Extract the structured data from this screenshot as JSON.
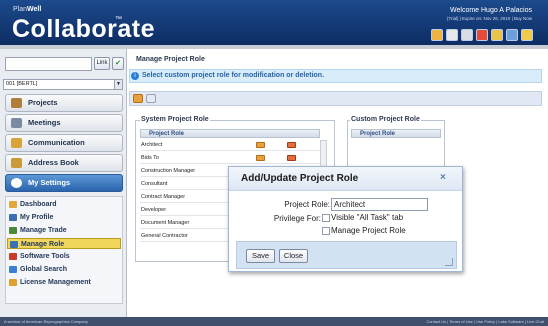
{
  "header": {
    "brand_top_a": "Plan",
    "brand_top_b": "Well",
    "brand_main": "Collaborate",
    "brand_tm": "™",
    "welcome": "Welcome Hugo A Palacios",
    "expire": "[Trial] | Expire on: Nov 26, 2010 | Buy Now",
    "toolbar_icons": [
      "help-icon",
      "home-icon",
      "print-icon",
      "close-icon",
      "mail-icon",
      "save-icon",
      "info-icon"
    ]
  },
  "sidebar": {
    "link_label": "Link",
    "project_value": "001 [BERTL]",
    "nav": [
      {
        "label": "Projects",
        "icon_color": "#b07d3a"
      },
      {
        "label": "Meetings",
        "icon_color": "#7a8aa0"
      },
      {
        "label": "Communication",
        "icon_color": "#d7a33a"
      },
      {
        "label": "Address Book",
        "icon_color": "#c9993a"
      },
      {
        "label": "My Settings",
        "icon_color": "#ffffff"
      }
    ],
    "submenu": [
      {
        "label": "Dashboard",
        "icon_color": "#e2a63c"
      },
      {
        "label": "My Profile",
        "icon_color": "#3a6fb2"
      },
      {
        "label": "Manage Trade",
        "icon_color": "#4a8a3c"
      },
      {
        "label": "Manage Role",
        "icon_color": "#3a6fb2"
      },
      {
        "label": "Software Tools",
        "icon_color": "#cc3a2a"
      },
      {
        "label": "Global Search",
        "icon_color": "#3a7fd0"
      },
      {
        "label": "License Management",
        "icon_color": "#e0a030"
      }
    ]
  },
  "main": {
    "title": "Manage Project Role",
    "info": "Select custom project role for modification or deletion.",
    "system_legend": "System Project Role",
    "system_col": "Project Role",
    "system_roles": [
      "Architect",
      "Bids To",
      "Construction Manager",
      "Consultant",
      "Contract Manager",
      "Developer",
      "Document Manager",
      "General Contractor"
    ],
    "custom_legend": "Custom Project Role",
    "custom_col": "Project Role"
  },
  "dialog": {
    "title": "Add/Update Project Role",
    "close": "×",
    "role_label": "Project Role:",
    "role_value": "Architect",
    "priv_label": "Privilege For:",
    "priv_1": "Visible \"All Task\" tab",
    "priv_2": "Manage Project Role",
    "save": "Save",
    "close_btn": "Close"
  },
  "footer": {
    "left": "A service of American Reprographics Company",
    "right": "Contact Us | Terms of Use | Use Policy | Labs Software | Live Chat"
  }
}
